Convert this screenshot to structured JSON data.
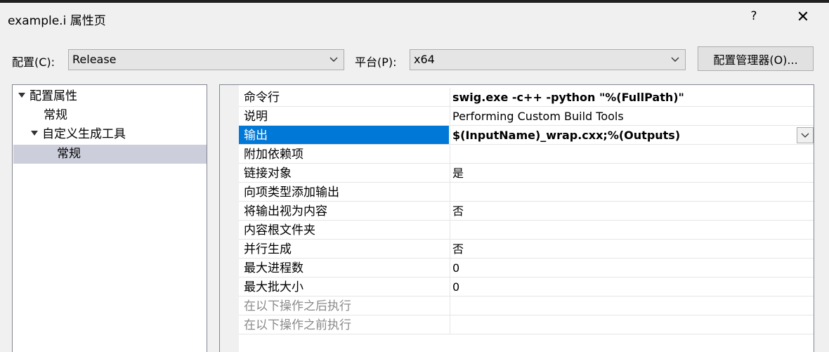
{
  "window": {
    "title": "example.i 属性页",
    "help_glyph": "?",
    "close_glyph": "✕"
  },
  "config": {
    "label": "配置(C):",
    "value": "Release"
  },
  "platform": {
    "label": "平台(P):",
    "value": "x64"
  },
  "config_manager_button": "配置管理器(O)...",
  "tree": {
    "items": [
      {
        "label": "配置属性",
        "expanded": true
      },
      {
        "label": "常规"
      },
      {
        "label": "自定义生成工具",
        "expanded": true
      },
      {
        "label": "常规",
        "selected": true
      }
    ]
  },
  "properties": {
    "rows": [
      {
        "name": "命令行",
        "value": "swig.exe -c++ -python \"%(FullPath)\""
      },
      {
        "name": "说明",
        "value": "Performing Custom Build Tools"
      },
      {
        "name": "输出",
        "value": "$(InputName)_wrap.cxx;%(Outputs)",
        "selected": true
      },
      {
        "name": "附加依赖项",
        "value": ""
      },
      {
        "name": "链接对象",
        "value": "是"
      },
      {
        "name": "向项类型添加输出",
        "value": ""
      },
      {
        "name": "将输出视为内容",
        "value": "否"
      },
      {
        "name": "内容根文件夹",
        "value": ""
      },
      {
        "name": "并行生成",
        "value": "否"
      },
      {
        "name": "最大进程数",
        "value": "0"
      },
      {
        "name": "最大批大小",
        "value": "0"
      },
      {
        "name": "在以下操作之后执行",
        "value": "",
        "disabled": true
      },
      {
        "name": "在以下操作之前执行",
        "value": "",
        "disabled": true
      }
    ]
  },
  "colors": {
    "selection": "#0078d7",
    "tree_selection": "#cccedb"
  }
}
